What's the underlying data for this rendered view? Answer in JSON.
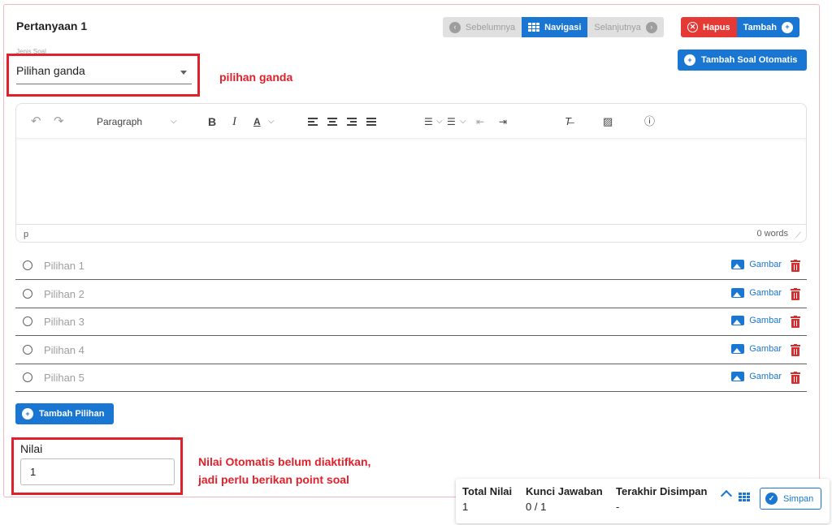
{
  "question": {
    "title": "Pertanyaan 1",
    "type_label": "Jenis Soal",
    "type_value": "Pilihan ganda"
  },
  "nav": {
    "prev_label": "Sebelumnya",
    "navigate_label": "Navigasi",
    "next_label": "Selanjutnya",
    "delete_label": "Hapus",
    "add_label": "Tambah",
    "auto_add_label": "Tambah Soal Otomatis"
  },
  "annotations": {
    "select_note": "pilihan ganda",
    "score_note_line1": "Nilai Otomatis belum diaktifkan,",
    "score_note_line2": "jadi perlu berikan point soal"
  },
  "editor": {
    "undo_icon": "↶",
    "redo_icon": "↷",
    "block_format": "Paragraph",
    "status_element": "p",
    "word_count": "0 words"
  },
  "options": [
    {
      "label": "Pilihan 1",
      "image_label": "Gambar"
    },
    {
      "label": "Pilihan 2",
      "image_label": "Gambar"
    },
    {
      "label": "Pilihan 3",
      "image_label": "Gambar"
    },
    {
      "label": "Pilihan 4",
      "image_label": "Gambar"
    },
    {
      "label": "Pilihan 5",
      "image_label": "Gambar"
    }
  ],
  "add_option_label": "Tambah Pilihan",
  "score": {
    "label": "Nilai",
    "value": "1"
  },
  "footer": {
    "total_label": "Total Nilai",
    "total_value": "1",
    "key_label": "Kunci Jawaban",
    "key_value": "0 / 1",
    "saved_label": "Terakhir Disimpan",
    "saved_value": "-",
    "save_label": "Simpan"
  },
  "colors": {
    "primary": "#1976d2",
    "danger": "#e53935",
    "annotation": "#e0202a"
  }
}
